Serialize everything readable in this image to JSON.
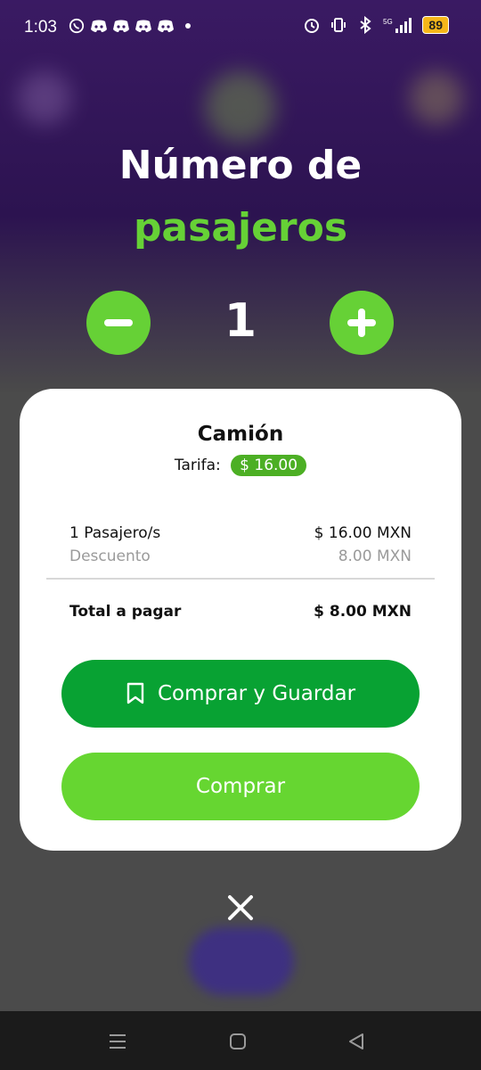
{
  "status_bar": {
    "time": "1:03",
    "battery": "89",
    "network": "5G"
  },
  "heading": {
    "line1": "Número de",
    "line2": "pasajeros"
  },
  "stepper": {
    "count": "1",
    "minus_icon": "minus-icon",
    "plus_icon": "plus-icon"
  },
  "card": {
    "title": "Camión",
    "fare_label": "Tarifa:",
    "fare_value": "$ 16.00",
    "passengers_label": "1 Pasajero/s",
    "passengers_amount": "$ 16.00 MXN",
    "discount_label": "Descuento",
    "discount_amount": "8.00 MXN",
    "total_label": "Total a pagar",
    "total_amount": "$ 8.00 MXN",
    "buy_save_label": "Comprar y Guardar",
    "buy_label": "Comprar"
  },
  "colors": {
    "accent_green": "#66d136",
    "dark_green": "#08a233",
    "background_purple": "#2c1350"
  }
}
